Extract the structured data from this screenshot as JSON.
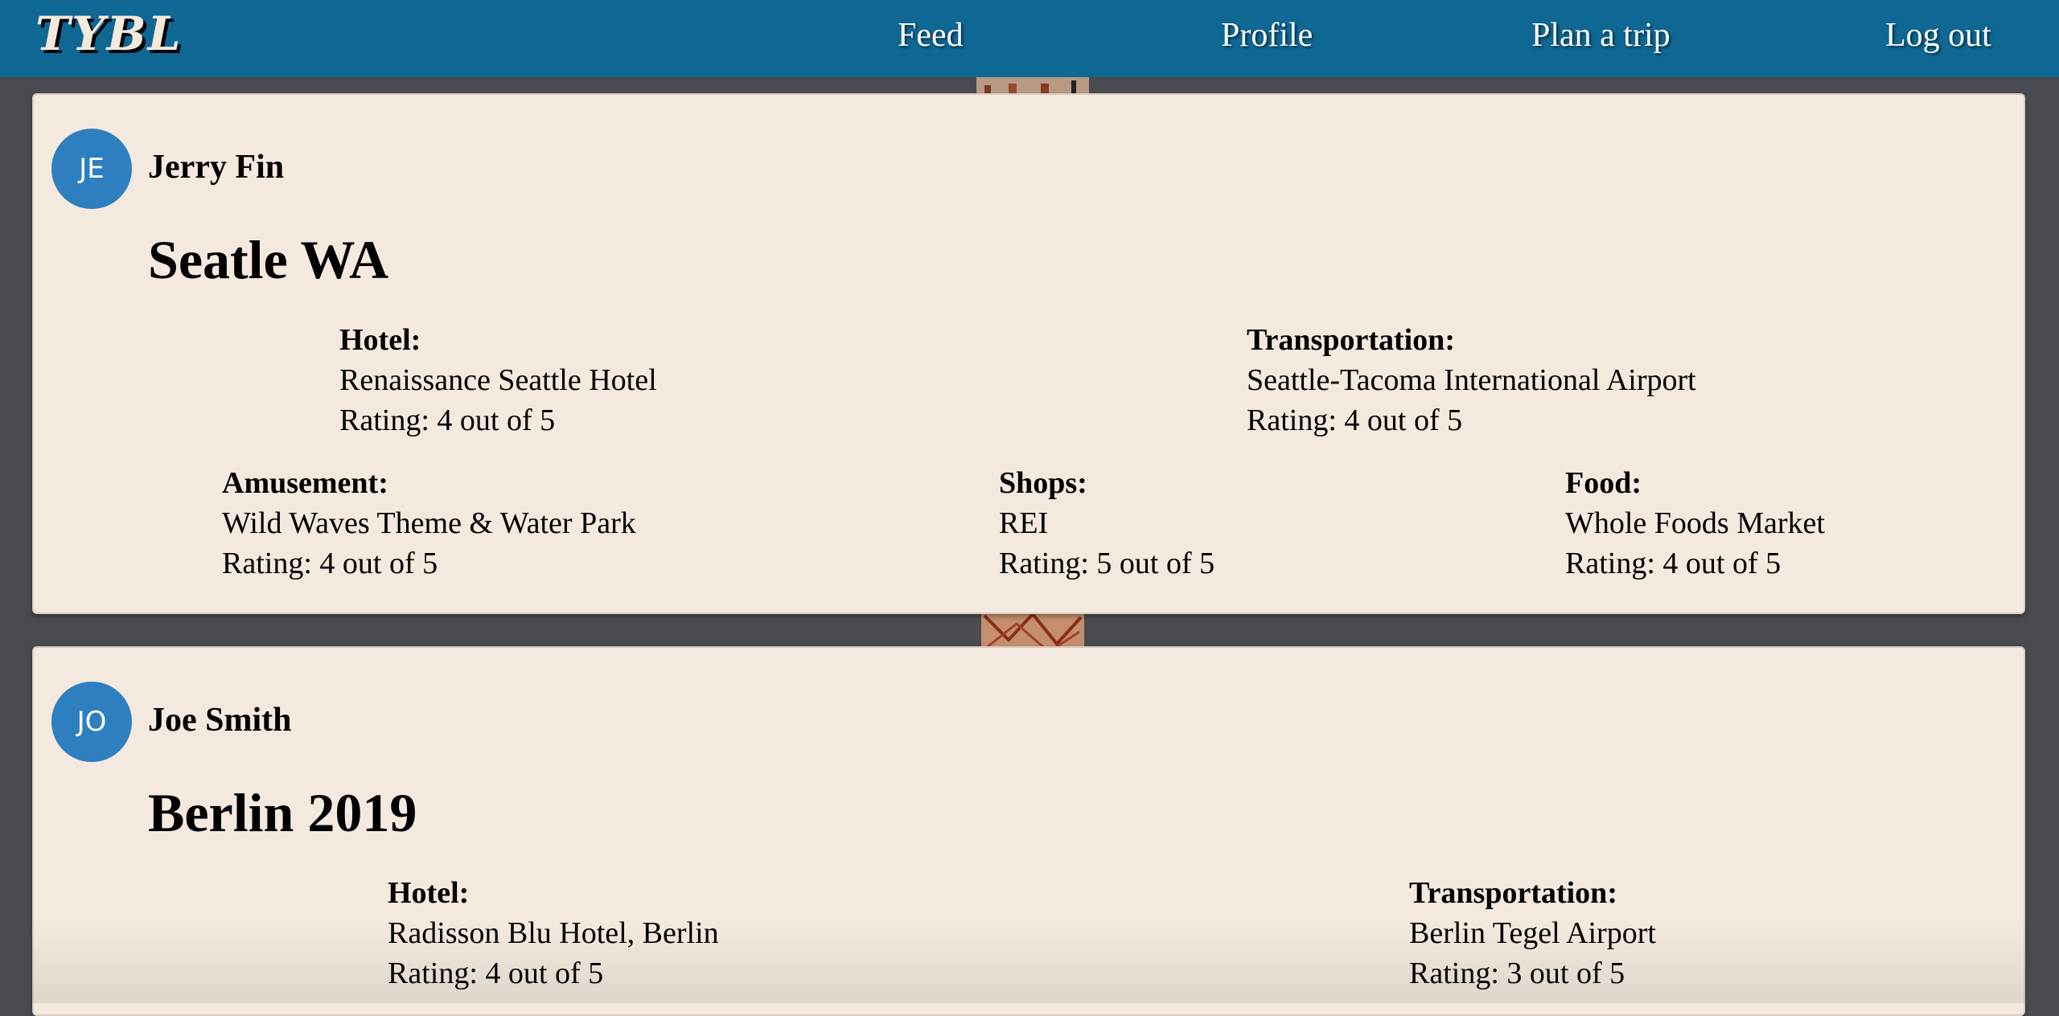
{
  "nav": {
    "logo": "TYBL",
    "links": [
      "Feed",
      "Profile",
      "Plan a trip",
      "Log out"
    ]
  },
  "posts": [
    {
      "initials": "JE",
      "author": "Jerry Fin",
      "title": "Seatle WA",
      "hotel": {
        "label": "Hotel:",
        "name": "Renaissance Seattle Hotel",
        "rating": "Rating: 4 out of 5"
      },
      "transportation": {
        "label": "Transportation:",
        "name": "Seattle-Tacoma International Airport",
        "rating": "Rating: 4 out of 5"
      },
      "amusement": {
        "label": "Amusement:",
        "name": "Wild Waves Theme & Water Park",
        "rating": "Rating: 4 out of 5"
      },
      "shops": {
        "label": "Shops:",
        "name": "REI",
        "rating": "Rating: 5 out of 5"
      },
      "food": {
        "label": "Food:",
        "name": "Whole Foods Market",
        "rating": "Rating: 4 out of 5"
      }
    },
    {
      "initials": "JO",
      "author": "Joe Smith",
      "title": "Berlin 2019",
      "hotel": {
        "label": "Hotel:",
        "name": "Radisson Blu Hotel, Berlin",
        "rating": "Rating: 4 out of 5"
      },
      "transportation": {
        "label": "Transportation:",
        "name": "Berlin Tegel Airport",
        "rating": "Rating: 3 out of 5"
      }
    }
  ],
  "colors": {
    "nav": "#0f6794",
    "card": "#f3e9de",
    "avatar": "#2e7fbf",
    "page": "#484b4f"
  }
}
